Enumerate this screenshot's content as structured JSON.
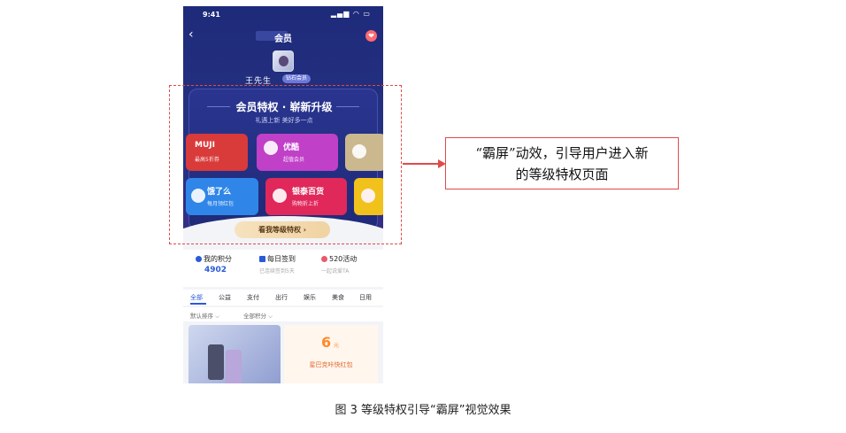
{
  "status": {
    "time": "9:41",
    "icons": "▂▄▆ ◠ ▭"
  },
  "nav": {
    "title": "会员",
    "back": "‹",
    "gift": "❤"
  },
  "user": {
    "name": "王先生",
    "badge": "钻石会员"
  },
  "card": {
    "title": "会员特权 · 崭新升级",
    "subtitle": "礼遇上新 美好多一点",
    "tiles": [
      {
        "title": "MUJI",
        "sub": "最高5折券",
        "color": "#d93a3a"
      },
      {
        "title": "优酷",
        "sub": "超值会员",
        "color": "#c040c8"
      },
      {
        "title": "",
        "sub": "",
        "color": "#cbb88f"
      },
      {
        "title": "饿了么",
        "sub": "每月领红包",
        "color": "#2f86e8"
      },
      {
        "title": "银泰百货",
        "sub": "购物折上折",
        "color": "#e0285a"
      },
      {
        "title": "",
        "sub": "",
        "color": "#f2c21c"
      }
    ],
    "button": "看我等级特权 ›"
  },
  "stats": [
    {
      "label": "我的积分",
      "value": "4902",
      "icon": "check-icon",
      "color": "#2a5ad8"
    },
    {
      "label": "每日签到",
      "sub": "已连续签到5天",
      "icon": "calendar-icon",
      "color": "#2a5ad8"
    },
    {
      "label": "520活动",
      "sub": "一起说爱TA",
      "icon": "heart-icon",
      "color": "#e85a6a"
    }
  ],
  "tabs": [
    "全部",
    "公益",
    "支付",
    "出行",
    "娱乐",
    "美食",
    "日用"
  ],
  "filters": [
    "默认排序 ⌵",
    "全部积分 ⌵"
  ],
  "coupon": {
    "amount": "6",
    "unit": "元",
    "text": "星巴克咔快红包"
  },
  "callout": {
    "line1": "“霸屏”动效，引导用户进入新",
    "line2": "的等级特权页面"
  },
  "caption": "图 3 等级特权引导“霸屏”视觉效果",
  "accent": "#e04a4a"
}
